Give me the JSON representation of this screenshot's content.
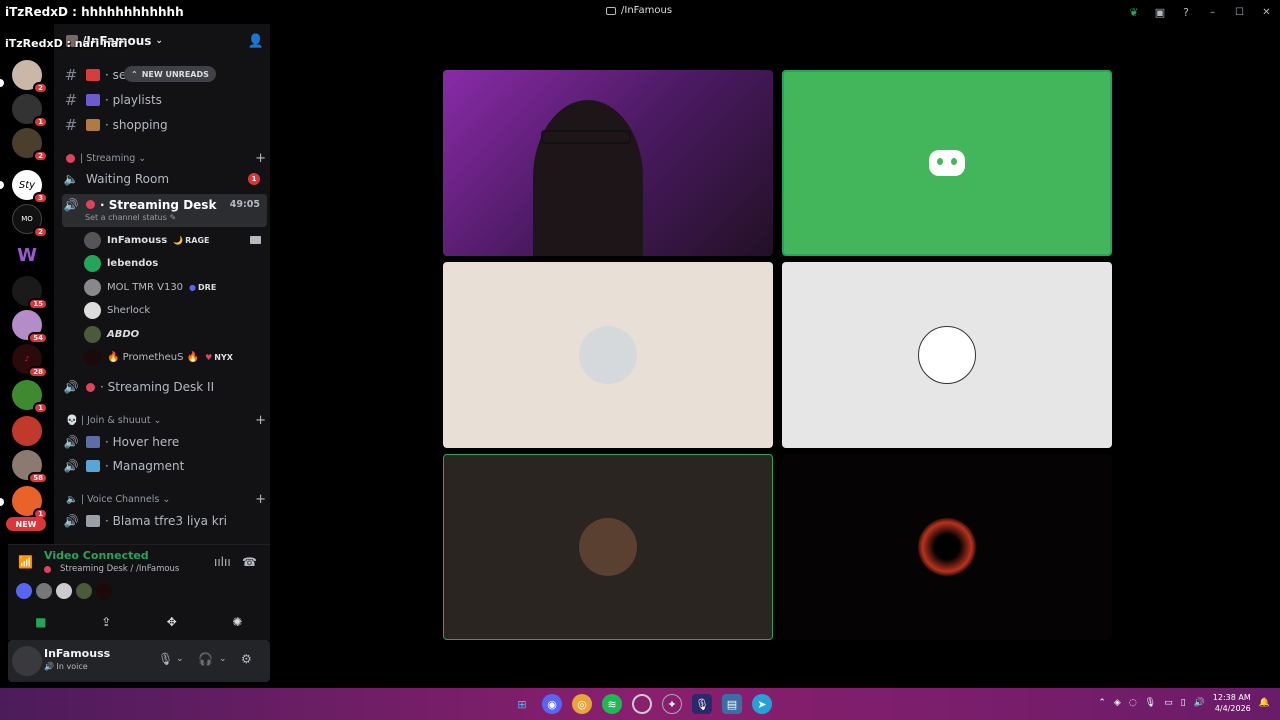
{
  "window": {
    "title": "/InFamous",
    "colors": {
      "accent": "#5865f2",
      "green": "#23a55a",
      "red": "#da373c",
      "bg": "#000000"
    }
  },
  "chat_overlay": {
    "line1": "iTzRedxD : hhhhhhhhhhhh",
    "line2": "iTzRedxD : nari nari"
  },
  "guilds": {
    "badges": [
      "2",
      "1",
      "2",
      "3",
      "2",
      "15",
      "54",
      "28",
      "1",
      "58",
      "1"
    ],
    "new_label": "NEW"
  },
  "server": {
    "name": "/InFamous",
    "new_unreads": "NEW UNREADS",
    "channels_top": [
      {
        "name": "· se",
        "emoji": "megaphone-icon"
      },
      {
        "name": "· playlists",
        "emoji": "music-note-icon"
      },
      {
        "name": "· shopping",
        "emoji": "box-icon"
      }
    ],
    "category_streaming": "| Streaming",
    "waiting_room": {
      "name": "Waiting Room",
      "badge": "1"
    },
    "streaming_desk": {
      "name": "· Streaming Desk",
      "timer": "49:05",
      "status": "Set a channel status"
    },
    "voice_users": [
      {
        "name": "InFamouss",
        "tag": "RAGE"
      },
      {
        "name": "lebendos",
        "tag": ""
      },
      {
        "name": "MOL TMR V130",
        "tag": "DRE"
      },
      {
        "name": "Sherlock",
        "tag": ""
      },
      {
        "name": "ABDO",
        "tag": ""
      },
      {
        "name": "🔥 PrometheuS 🔥",
        "tag": "NYX"
      }
    ],
    "streaming_desk_2": "· Streaming Desk II",
    "category_join": "| Join & shuuut",
    "hover_here": "· Hover here",
    "managment": "· Managment",
    "category_voice": "| Voice Channels",
    "blama": "· Blama tfre3 liya kri"
  },
  "rtc": {
    "title": "Video Connected",
    "subtitle": "Streaming Desk / /InFamous"
  },
  "user": {
    "name": "InFamouss",
    "status": "In voice"
  },
  "taskbar": {
    "time": "12:38 AM",
    "date": "4/4/2026"
  }
}
